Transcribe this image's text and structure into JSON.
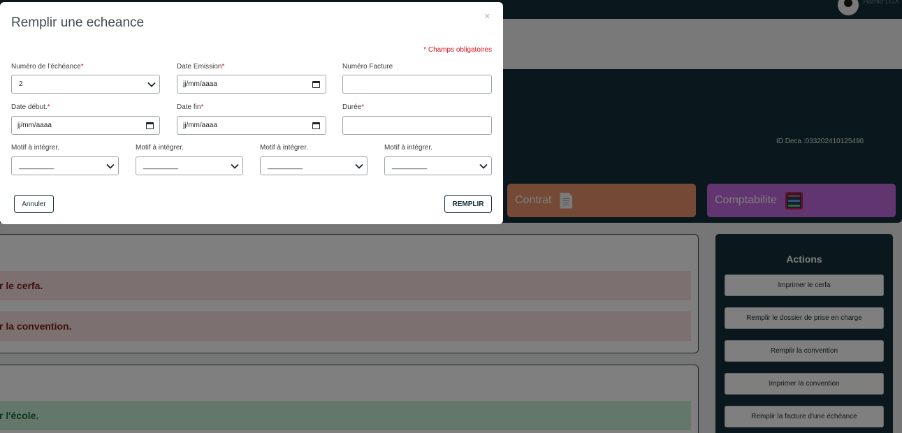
{
  "header": {
    "user_name": "Hamid LGX"
  },
  "hero": {
    "id_deca": "ID Deca :033202410125490"
  },
  "tabs": {
    "contrat": "Contrat",
    "comptabilite": "Comptabilite"
  },
  "panels": {
    "alert_cerfa": "r le cerfa.",
    "alert_convention": "r la convention.",
    "alert_ecole": "r l'école."
  },
  "actions": {
    "title": "Actions",
    "items": [
      "Imprimer le cerfa",
      "Remplir le dossier de prise en charge",
      "Remplir la convention",
      "Imprimer la convention",
      "Remplir la facture d'une échéance"
    ]
  },
  "modal": {
    "title": "Remplir une echeance",
    "close": "×",
    "required_note": "* Champs obligatoires",
    "numero_echeance": {
      "label": "Numéro de l'échéance",
      "value": "2"
    },
    "date_emission": {
      "label": "Date Emission",
      "value": "jj/mm/aaaa"
    },
    "numero_facture": {
      "label": "Numéro Facture",
      "value": ""
    },
    "date_debut": {
      "label": "Date début.",
      "value": "jj/mm/aaaa"
    },
    "date_fin": {
      "label": "Date fin",
      "value": "jj/mm/aaaa"
    },
    "duree": {
      "label": "Durée",
      "value": ""
    },
    "motifs": [
      {
        "label": "Motif à intégrer.",
        "value": "_________"
      },
      {
        "label": "Motif à intégrer.",
        "value": "_________"
      },
      {
        "label": "Motif à intégrer.",
        "value": "_________"
      },
      {
        "label": "Motif à intégrer.",
        "value": "_________"
      }
    ],
    "cancel": "Annuler",
    "submit": "REMPLIR",
    "required_star": "*"
  },
  "colors": {
    "dark": "#14303a",
    "contrat": "#e9926b",
    "comptabilite": "#c06be0",
    "required": "#d9121b"
  }
}
